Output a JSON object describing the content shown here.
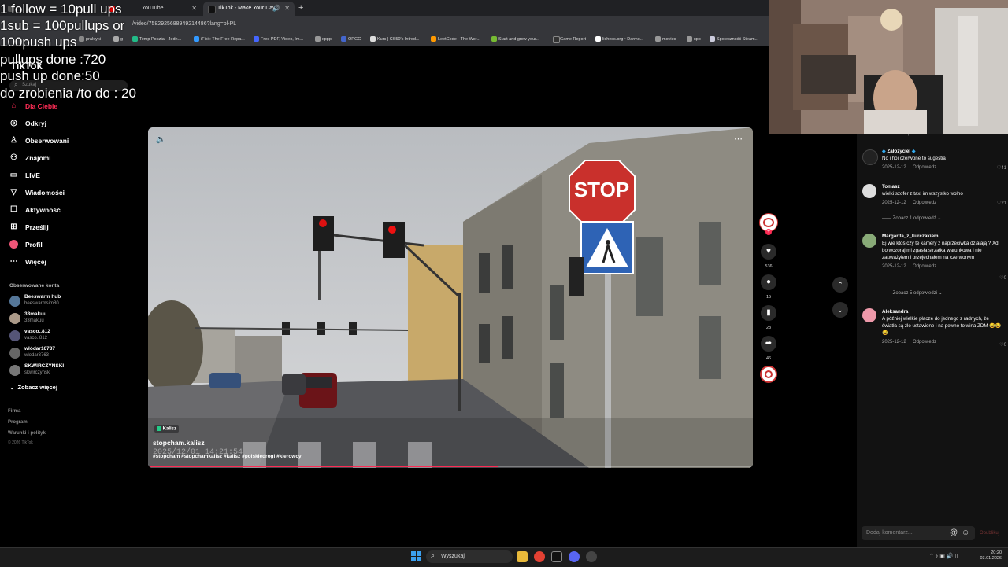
{
  "browser": {
    "tabs": [
      {
        "label": "YouTube",
        "active": false
      },
      {
        "label": "TikTok - Make Your Day",
        "active": true
      }
    ],
    "new_tab": "+",
    "url": "/video/7582925688949214486?lang=pl-PL",
    "bookmarks": [
      "praktyki",
      "g",
      "Temp Poczta - Jedn...",
      "iFixit: The Free Repa...",
      "Free PDF, Video, Im...",
      "xppp",
      "OPGG",
      "Kurs | CS50's Introd...",
      "LeetCode - The Wor...",
      "Start and grow your...",
      "Game Report",
      "lichess.org • Darmo...",
      "movies",
      "xpp",
      "Społeczność Steam..."
    ]
  },
  "overlay": {
    "lines": [
      "1 follow = 10pull ups",
      "1sub = 100pullups or",
      "100push ups",
      "pullups done :720",
      "push up done:50",
      "do zrobienia /to do :  20"
    ]
  },
  "sidebar": {
    "logo": "TikTok",
    "search_placeholder": "Szukaj",
    "nav": [
      {
        "label": "Dla Ciebie",
        "icon": "home-icon",
        "active": true
      },
      {
        "label": "Odkryj",
        "icon": "compass-icon"
      },
      {
        "label": "Obserwowani",
        "icon": "user-follow-icon"
      },
      {
        "label": "Znajomi",
        "icon": "friends-icon"
      },
      {
        "label": "LIVE",
        "icon": "live-icon"
      },
      {
        "label": "Wiadomości",
        "icon": "messages-icon"
      },
      {
        "label": "Aktywność",
        "icon": "activity-icon"
      },
      {
        "label": "Prześlij",
        "icon": "upload-icon"
      },
      {
        "label": "Profil",
        "icon": "profile-icon"
      },
      {
        "label": "Więcej",
        "icon": "more-icon"
      }
    ],
    "following_header": "Obserwowane konta",
    "accounts": [
      {
        "name": "Beeswarm hub",
        "handle": "beeswarmsim80"
      },
      {
        "name": "33makuu",
        "handle": "33makuu"
      },
      {
        "name": "vasco..812",
        "handle": "vasco..812"
      },
      {
        "name": "włódar16737",
        "handle": "wlodar3763"
      },
      {
        "name": "SKWIRCZYNSKI",
        "handle": "skwirczynski"
      }
    ],
    "see_more": "Zobacz więcej",
    "footer": [
      "Firma",
      "Program",
      "Warunki i polityki",
      "© 2026 TikTok"
    ]
  },
  "video": {
    "location_tag": "Kalisz",
    "author": "stopcham.kalisz",
    "timestamp": "2025/12/01 14:21:54",
    "hashtags": "#stopcham #stopchamkalisz #kalisz #polskiedrogi #kierowcy",
    "sign_text": "STOP",
    "progress": 0.58
  },
  "rail": {
    "likes": "536",
    "comments": "15",
    "saves": "23",
    "shares": "46"
  },
  "comments": {
    "top_partial": "Zobacz 1 odpowiedź",
    "items": [
      {
        "name": "Założyciel",
        "text": "No i hoi czerwone to sugestia",
        "date": "2025-12-12",
        "reply": "Odpowiedz",
        "likes": "41"
      },
      {
        "name": "Tomasz",
        "text": "wielki szofer z taxi im wszystko wolno",
        "date": "2025-12-12",
        "reply": "Odpowiedz",
        "likes": "21",
        "more": "Zobacz 1 odpowiedź"
      },
      {
        "name": "Margarita_z_kurczakiem",
        "text": "Ej wie ktoś czy te kamery z naprzeciwka działają ? Xd bo wczoraj mi zgasła strzałka warunkowa i nie zauważyłem i przejechałem na czerwonym",
        "date": "2025-12-12",
        "reply": "Odpowiedz",
        "likes": "0",
        "more": "Zobacz 5 odpowiedzi"
      },
      {
        "name": "Aleksandra",
        "text": "A później wielkie płacze do jednego z radnych, że światła są źle ustawione i na pewno to wina ZDM 😂😂😂",
        "date": "2025-12-12",
        "reply": "Odpowiedz",
        "likes": "0"
      }
    ],
    "input_placeholder": "Dodaj komentarz...",
    "post_label": "Opublikuj"
  },
  "taskbar": {
    "search_label": "Wyszukaj",
    "time": "20:20",
    "date": "03.01.2026"
  }
}
